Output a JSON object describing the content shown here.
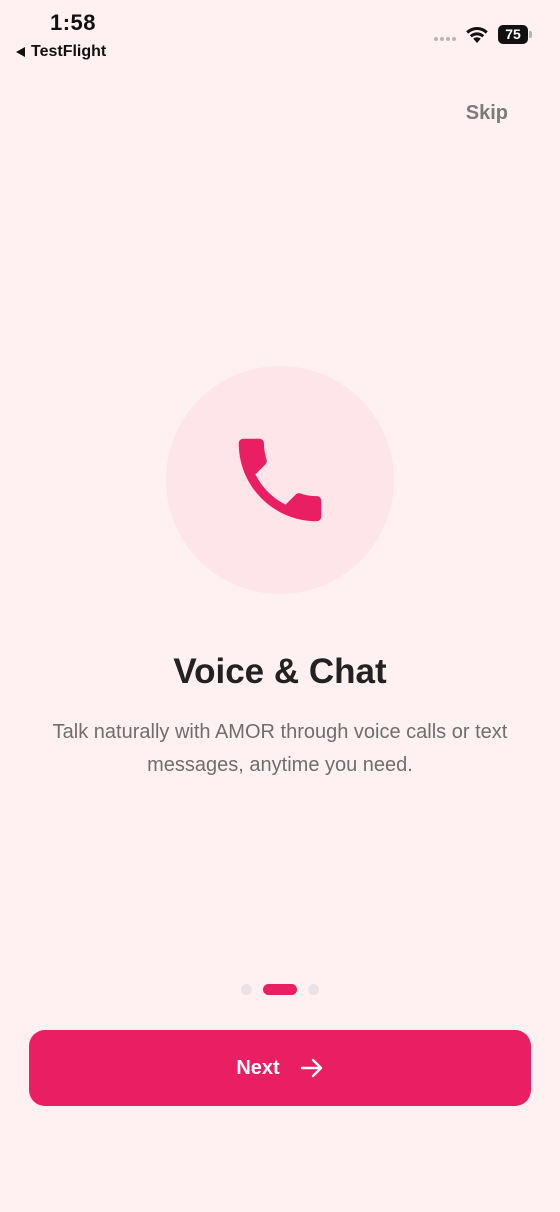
{
  "status_bar": {
    "time": "1:58",
    "back_app": "TestFlight",
    "battery": "75",
    "icons": [
      "signal-dots-icon",
      "wifi-icon",
      "battery-icon"
    ]
  },
  "header": {
    "skip_label": "Skip"
  },
  "hero": {
    "icon": "phone-icon",
    "accent_color": "#E91E63",
    "circle_color": "#FDE5EA"
  },
  "content": {
    "title": "Voice & Chat",
    "description": "Talk naturally with AMOR through voice calls or text messages, anytime you need."
  },
  "pager": {
    "count": 3,
    "active_index": 1
  },
  "footer": {
    "next_label": "Next",
    "next_icon": "arrow-right-icon"
  },
  "colors": {
    "background": "#FFF0F2",
    "primary": "#E91E63",
    "title": "#222222",
    "body_text": "#6E6E6E"
  }
}
